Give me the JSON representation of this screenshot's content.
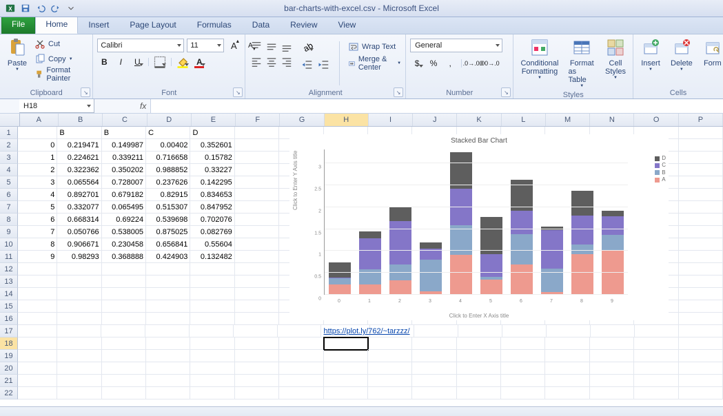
{
  "window": {
    "title": "bar-charts-with-excel.csv - Microsoft Excel"
  },
  "tabs": {
    "file": "File",
    "items": [
      "Home",
      "Insert",
      "Page Layout",
      "Formulas",
      "Data",
      "Review",
      "View"
    ],
    "active": "Home"
  },
  "ribbon": {
    "clipboard": {
      "label": "Clipboard",
      "paste": "Paste",
      "cut": "Cut",
      "copy": "Copy",
      "format_painter": "Format Painter"
    },
    "font": {
      "label": "Font",
      "family": "Calibri",
      "size": "11"
    },
    "alignment": {
      "label": "Alignment",
      "wrap": "Wrap Text",
      "merge": "Merge & Center"
    },
    "number": {
      "label": "Number",
      "format": "General"
    },
    "styles": {
      "label": "Styles",
      "cond": "Conditional",
      "cond2": "Formatting",
      "table": "Format",
      "table2": "as Table",
      "cell": "Cell",
      "cell2": "Styles"
    },
    "cells": {
      "label": "Cells",
      "insert": "Insert",
      "delete": "Delete",
      "format": "Form"
    }
  },
  "namebox": "H18",
  "columns": [
    "A",
    "B",
    "C",
    "D",
    "E",
    "F",
    "G",
    "H",
    "I",
    "J",
    "K",
    "L",
    "M",
    "N",
    "O",
    "P"
  ],
  "headers": {
    "B": "B",
    "C": "B",
    "D": "C",
    "E": "D"
  },
  "grid": [
    {
      "A": "0",
      "B": "0.219471",
      "C": "0.149987",
      "D": "0.00402",
      "E": "0.352601"
    },
    {
      "A": "1",
      "B": "0.224621",
      "C": "0.339211",
      "D": "0.716658",
      "E": "0.15782"
    },
    {
      "A": "2",
      "B": "0.322362",
      "C": "0.350202",
      "D": "0.988852",
      "E": "0.33227"
    },
    {
      "A": "3",
      "B": "0.065564",
      "C": "0.728007",
      "D": "0.237626",
      "E": "0.142295"
    },
    {
      "A": "4",
      "B": "0.892701",
      "C": "0.679182",
      "D": "0.82915",
      "E": "0.834653"
    },
    {
      "A": "5",
      "B": "0.332077",
      "C": "0.065495",
      "D": "0.515307",
      "E": "0.847952"
    },
    {
      "A": "6",
      "B": "0.668314",
      "C": "0.69224",
      "D": "0.539698",
      "E": "0.702076"
    },
    {
      "A": "7",
      "B": "0.050766",
      "C": "0.538005",
      "D": "0.875025",
      "E": "0.082769"
    },
    {
      "A": "8",
      "B": "0.906671",
      "C": "0.230458",
      "D": "0.656841",
      "E": "0.55604"
    },
    {
      "A": "9",
      "B": "0.98293",
      "C": "0.368888",
      "D": "0.424903",
      "E": "0.132482"
    }
  ],
  "link_row": 17,
  "link_col": "H",
  "link_text": "https://plot.ly/762/~tarzzz/",
  "active_cell": {
    "row": 18,
    "col": "H"
  },
  "chart_data": {
    "type": "bar",
    "stacked": true,
    "title": "Stacked Bar Chart",
    "xlabel": "Click to Enter X Axis title",
    "ylabel": "Click to Enter Y Axis title",
    "categories": [
      "0",
      "1",
      "2",
      "3",
      "4",
      "5",
      "6",
      "7",
      "8",
      "9"
    ],
    "series": [
      {
        "name": "A",
        "values": [
          0.219471,
          0.224621,
          0.322362,
          0.065564,
          0.892701,
          0.332077,
          0.668314,
          0.050766,
          0.906671,
          0.98293
        ]
      },
      {
        "name": "B",
        "values": [
          0.149987,
          0.339211,
          0.350202,
          0.728007,
          0.679182,
          0.065495,
          0.69224,
          0.538005,
          0.230458,
          0.368888
        ]
      },
      {
        "name": "C",
        "values": [
          0.00402,
          0.716658,
          0.988852,
          0.237626,
          0.82915,
          0.515307,
          0.539698,
          0.875025,
          0.656841,
          0.424903
        ]
      },
      {
        "name": "D",
        "values": [
          0.352601,
          0.15782,
          0.33227,
          0.142295,
          0.834653,
          0.847952,
          0.702076,
          0.082769,
          0.55604,
          0.132482
        ]
      }
    ],
    "yticks": [
      0,
      0.5,
      1,
      1.5,
      2,
      2.5,
      3
    ],
    "ylim": [
      0,
      3.3
    ],
    "legend": [
      "D",
      "C",
      "B",
      "A"
    ]
  }
}
